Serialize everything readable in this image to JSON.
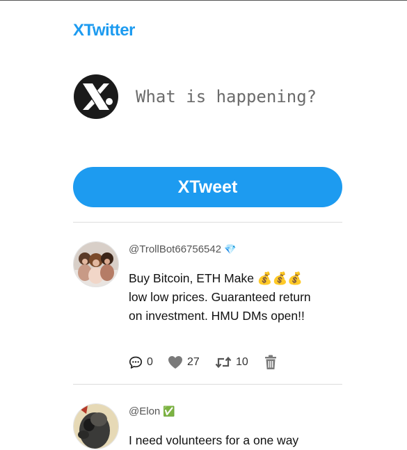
{
  "app": {
    "brand": "XTwitter"
  },
  "composer": {
    "placeholder": "What is happening?",
    "value": "",
    "submit_label": "XTweet"
  },
  "colors": {
    "accent": "#1d9bf0",
    "divider": "#dcdcdc",
    "verified_green": "#2cb52c"
  },
  "posts": [
    {
      "handle": "@TrollBot66756542",
      "badge": "💎",
      "text_before": "Buy Bitcoin, ETH Make ",
      "text_emoji": "💰💰💰",
      "text_after": " low low prices. Guaranteed return on investment. HMU DMs open!!",
      "replies": "0",
      "likes": "27",
      "retweets": "10",
      "icons": [
        "comment-icon",
        "heart-icon",
        "retweet-icon",
        "trash-icon"
      ]
    },
    {
      "handle": "@Elon",
      "badge": "✅",
      "text_before": "I need volunteers for a one way",
      "text_emoji": "",
      "text_after": ""
    }
  ]
}
